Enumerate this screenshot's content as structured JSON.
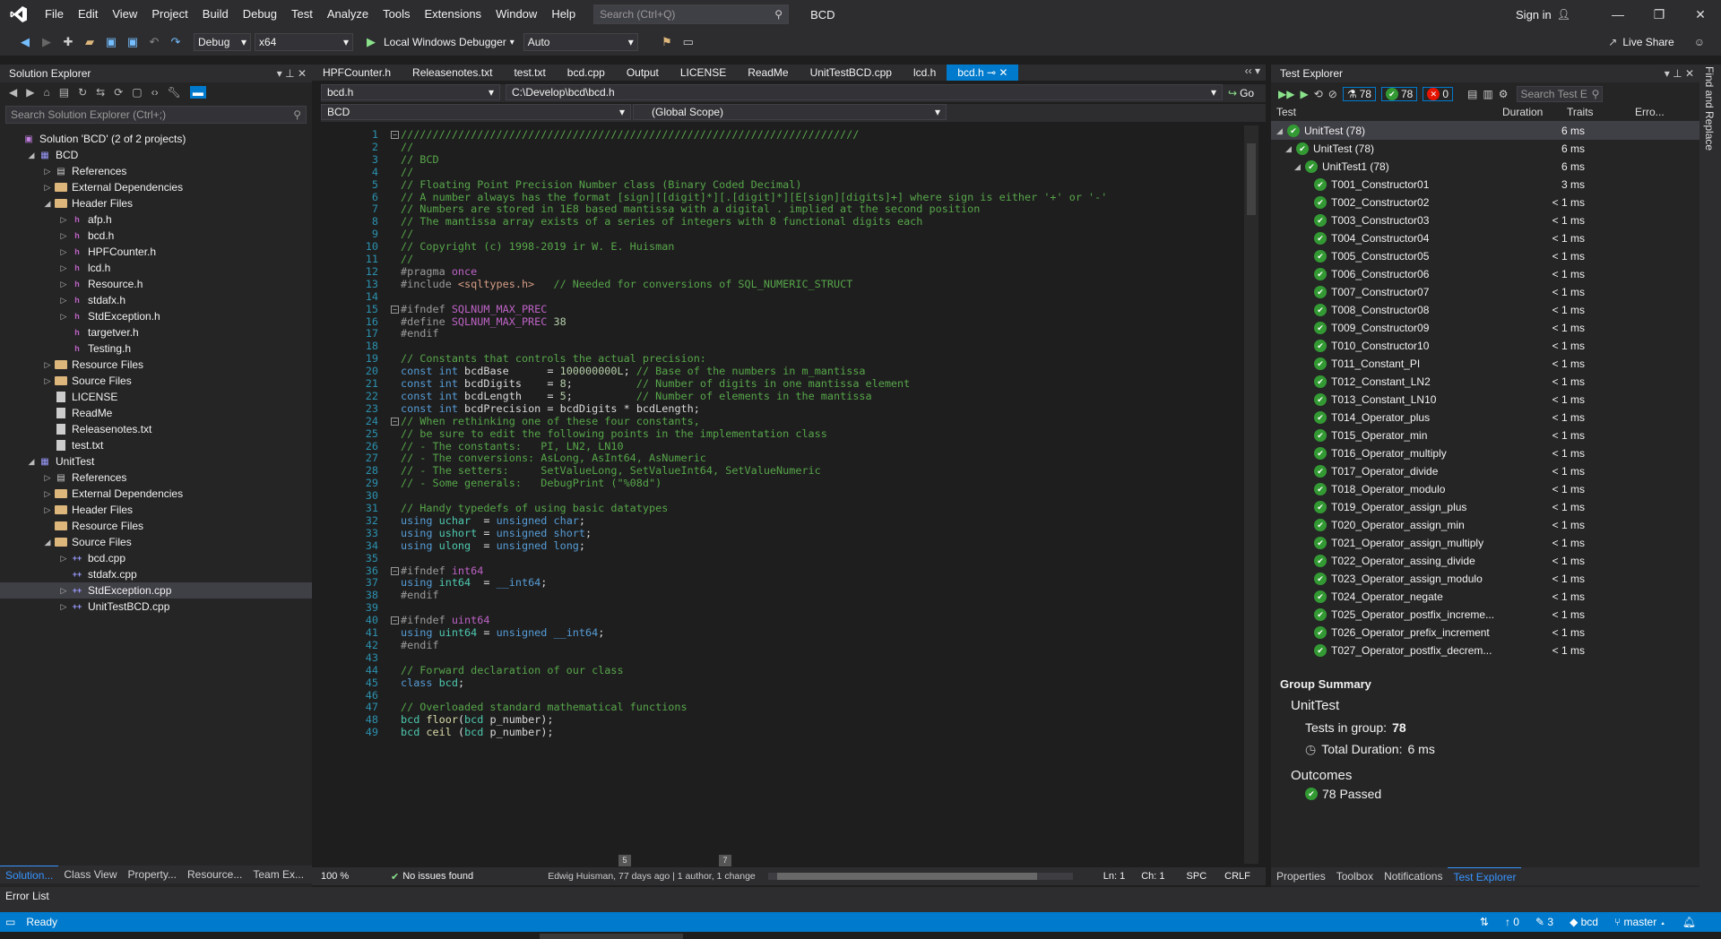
{
  "menubar": {
    "items": [
      "File",
      "Edit",
      "View",
      "Project",
      "Build",
      "Debug",
      "Test",
      "Analyze",
      "Tools",
      "Extensions",
      "Window",
      "Help"
    ],
    "search_placeholder": "Search (Ctrl+Q)",
    "solution_name": "BCD",
    "sign_in": "Sign in"
  },
  "toolbar": {
    "config": "Debug",
    "platform": "x64",
    "debugger": "Local Windows Debugger",
    "auto": "Auto",
    "live_share": "Live Share"
  },
  "solution_explorer": {
    "title": "Solution Explorer",
    "search_placeholder": "Search Solution Explorer (Ctrl+;)",
    "rows": [
      {
        "label": "Solution 'BCD' (2 of 2 projects)",
        "level": 0,
        "tw": "",
        "icon": "solution"
      },
      {
        "label": "BCD",
        "level": 1,
        "tw": "◢",
        "icon": "project"
      },
      {
        "label": "References",
        "level": 2,
        "tw": "▷",
        "icon": "refs"
      },
      {
        "label": "External Dependencies",
        "level": 2,
        "tw": "▷",
        "icon": "folder"
      },
      {
        "label": "Header Files",
        "level": 2,
        "tw": "◢",
        "icon": "folder"
      },
      {
        "label": "afp.h",
        "level": 3,
        "tw": "▷",
        "icon": "h"
      },
      {
        "label": "bcd.h",
        "level": 3,
        "tw": "▷",
        "icon": "h"
      },
      {
        "label": "HPFCounter.h",
        "level": 3,
        "tw": "▷",
        "icon": "h"
      },
      {
        "label": "lcd.h",
        "level": 3,
        "tw": "▷",
        "icon": "h"
      },
      {
        "label": "Resource.h",
        "level": 3,
        "tw": "▷",
        "icon": "h"
      },
      {
        "label": "stdafx.h",
        "level": 3,
        "tw": "▷",
        "icon": "h"
      },
      {
        "label": "StdException.h",
        "level": 3,
        "tw": "▷",
        "icon": "h"
      },
      {
        "label": "targetver.h",
        "level": 3,
        "tw": "",
        "icon": "h"
      },
      {
        "label": "Testing.h",
        "level": 3,
        "tw": "",
        "icon": "h"
      },
      {
        "label": "Resource Files",
        "level": 2,
        "tw": "▷",
        "icon": "folder"
      },
      {
        "label": "Source Files",
        "level": 2,
        "tw": "▷",
        "icon": "folder"
      },
      {
        "label": "LICENSE",
        "level": 2,
        "tw": "",
        "icon": "txt"
      },
      {
        "label": "ReadMe",
        "level": 2,
        "tw": "",
        "icon": "txt"
      },
      {
        "label": "Releasenotes.txt",
        "level": 2,
        "tw": "",
        "icon": "txt"
      },
      {
        "label": "test.txt",
        "level": 2,
        "tw": "",
        "icon": "txt"
      },
      {
        "label": "UnitTest",
        "level": 1,
        "tw": "◢",
        "icon": "project"
      },
      {
        "label": "References",
        "level": 2,
        "tw": "▷",
        "icon": "refs"
      },
      {
        "label": "External Dependencies",
        "level": 2,
        "tw": "▷",
        "icon": "folder"
      },
      {
        "label": "Header Files",
        "level": 2,
        "tw": "▷",
        "icon": "folder"
      },
      {
        "label": "Resource Files",
        "level": 2,
        "tw": "",
        "icon": "folder"
      },
      {
        "label": "Source Files",
        "level": 2,
        "tw": "◢",
        "icon": "folder"
      },
      {
        "label": "bcd.cpp",
        "level": 3,
        "tw": "▷",
        "icon": "cpp"
      },
      {
        "label": "stdafx.cpp",
        "level": 3,
        "tw": "",
        "icon": "cpp"
      },
      {
        "label": "StdException.cpp",
        "level": 3,
        "tw": "▷",
        "icon": "cpp",
        "selected": true
      },
      {
        "label": "UnitTestBCD.cpp",
        "level": 3,
        "tw": "▷",
        "icon": "cpp"
      }
    ],
    "bottom_tabs": [
      "Solution...",
      "Class View",
      "Property...",
      "Resource...",
      "Team Ex..."
    ]
  },
  "editor": {
    "tabs": [
      "HPFCounter.h",
      "Releasenotes.txt",
      "test.txt",
      "bcd.cpp",
      "Output",
      "LICENSE",
      "ReadMe",
      "UnitTestBCD.cpp",
      "lcd.h",
      "bcd.h"
    ],
    "active_tab": "bcd.h",
    "nav_file": "bcd.h",
    "nav_path": "C:\\Develop\\bcd\\bcd.h",
    "nav_go": "Go",
    "nav_project": "BCD",
    "nav_scope": "(Global Scope)",
    "lines": [
      "////////////////////////////////////////////////////////////////////////",
      "//",
      "// BCD",
      "//",
      "// Floating Point Precision Number class (Binary Coded Decimal)",
      "// A number always has the format [sign][[digit]*][.[digit]*][E[sign][digits]+] where sign is either '+' or '-'",
      "// Numbers are stored in 1E8 based mantissa with a digital . implied at the second position",
      "// The mantissa array exists of a series of integers with 8 functional digits each",
      "//",
      "// Copyright (c) 1998-2019 ir W. E. Huisman",
      "//",
      "#pragma once",
      "#include <sqltypes.h>   // Needed for conversions of SQL_NUMERIC_STRUCT",
      "",
      "#ifndef SQLNUM_MAX_PREC",
      "#define SQLNUM_MAX_PREC 38",
      "#endif",
      "",
      "// Constants that controls the actual precision:",
      "const int bcdBase      = 100000000L; // Base of the numbers in m_mantissa",
      "const int bcdDigits    = 8;          // Number of digits in one mantissa element",
      "const int bcdLength    = 5;          // Number of elements in the mantissa",
      "const int bcdPrecision = bcdDigits * bcdLength;",
      "// When rethinking one of these four constants,",
      "// be sure to edit the following points in the implementation class",
      "// - The constants:   PI, LN2, LN10",
      "// - The conversions: AsLong, AsInt64, AsNumeric",
      "// - The setters:     SetValueLong, SetValueInt64, SetValueNumeric",
      "// - Some generals:   DebugPrint (\"%08d\")",
      "",
      "// Handy typedefs of using basic datatypes",
      "using uchar  = unsigned char;",
      "using ushort = unsigned short;",
      "using ulong  = unsigned long;",
      "",
      "#ifndef int64",
      "using int64  = __int64;",
      "#endif",
      "",
      "#ifndef uint64",
      "using uint64 = unsigned __int64;",
      "#endif",
      "",
      "// Forward declaration of our class",
      "class bcd;",
      "",
      "// Overloaded standard mathematical functions",
      "bcd floor(bcd p_number);",
      "bcd ceil (bcd p_number);"
    ],
    "line_numbers": [
      "1",
      "2",
      "3",
      "4",
      "5",
      "6",
      "7",
      "8",
      "9",
      "10",
      "11",
      "12",
      "13",
      "14",
      "15",
      "16",
      "17",
      "18",
      "19",
      "20",
      "21",
      "22",
      "23",
      "24",
      "25",
      "26",
      "27",
      "28",
      "29",
      "30",
      "31",
      "32",
      "33",
      "34",
      "35",
      "36",
      "37",
      "38",
      "39",
      "40",
      "41",
      "42",
      "43",
      "44",
      "45",
      "46",
      "47",
      "48",
      "49"
    ],
    "status": {
      "zoom": "100 %",
      "issues": "No issues found",
      "blame": "Edwig Huisman, 77 days ago | 1 author, 1 change",
      "ln": "Ln: 1",
      "ch": "Ch: 1",
      "spc": "SPC",
      "crlf": "CRLF"
    },
    "scroll_marker_1": "5",
    "scroll_marker_2": "7"
  },
  "test_explorer": {
    "title": "Test Explorer",
    "total_count": "78",
    "passed_count": "78",
    "failed_count": "0",
    "search_placeholder": "Search Test E",
    "columns": {
      "test": "Test",
      "duration": "Duration",
      "traits": "Traits",
      "error": "Erro..."
    },
    "tests": [
      {
        "name": "UnitTest (78)",
        "dur": "6 ms",
        "level": 0
      },
      {
        "name": "UnitTest (78)",
        "dur": "6 ms",
        "level": 1
      },
      {
        "name": "UnitTest1 (78)",
        "dur": "6 ms",
        "level": 2
      },
      {
        "name": "T001_Constructor01",
        "dur": "3 ms",
        "level": 3
      },
      {
        "name": "T002_Constructor02",
        "dur": "< 1 ms",
        "level": 3
      },
      {
        "name": "T003_Constructor03",
        "dur": "< 1 ms",
        "level": 3
      },
      {
        "name": "T004_Constructor04",
        "dur": "< 1 ms",
        "level": 3
      },
      {
        "name": "T005_Constructor05",
        "dur": "< 1 ms",
        "level": 3
      },
      {
        "name": "T006_Constructor06",
        "dur": "< 1 ms",
        "level": 3
      },
      {
        "name": "T007_Constructor07",
        "dur": "< 1 ms",
        "level": 3
      },
      {
        "name": "T008_Constructor08",
        "dur": "< 1 ms",
        "level": 3
      },
      {
        "name": "T009_Constructor09",
        "dur": "< 1 ms",
        "level": 3
      },
      {
        "name": "T010_Constructor10",
        "dur": "< 1 ms",
        "level": 3
      },
      {
        "name": "T011_Constant_PI",
        "dur": "< 1 ms",
        "level": 3
      },
      {
        "name": "T012_Constant_LN2",
        "dur": "< 1 ms",
        "level": 3
      },
      {
        "name": "T013_Constant_LN10",
        "dur": "< 1 ms",
        "level": 3
      },
      {
        "name": "T014_Operator_plus",
        "dur": "< 1 ms",
        "level": 3
      },
      {
        "name": "T015_Operator_min",
        "dur": "< 1 ms",
        "level": 3
      },
      {
        "name": "T016_Operator_multiply",
        "dur": "< 1 ms",
        "level": 3
      },
      {
        "name": "T017_Operator_divide",
        "dur": "< 1 ms",
        "level": 3
      },
      {
        "name": "T018_Operator_modulo",
        "dur": "< 1 ms",
        "level": 3
      },
      {
        "name": "T019_Operator_assign_plus",
        "dur": "< 1 ms",
        "level": 3
      },
      {
        "name": "T020_Operator_assign_min",
        "dur": "< 1 ms",
        "level": 3
      },
      {
        "name": "T021_Operator_assign_multiply",
        "dur": "< 1 ms",
        "level": 3
      },
      {
        "name": "T022_Operator_assing_divide",
        "dur": "< 1 ms",
        "level": 3
      },
      {
        "name": "T023_Operator_assign_modulo",
        "dur": "< 1 ms",
        "level": 3
      },
      {
        "name": "T024_Operator_negate",
        "dur": "< 1 ms",
        "level": 3
      },
      {
        "name": "T025_Operator_postfix_increme...",
        "dur": "< 1 ms",
        "level": 3
      },
      {
        "name": "T026_Operator_prefix_increment",
        "dur": "< 1 ms",
        "level": 3
      },
      {
        "name": "T027_Operator_postfix_decrem...",
        "dur": "< 1 ms",
        "level": 3
      }
    ],
    "summary": {
      "heading": "Group Summary",
      "group": "UnitTest",
      "tests_in_group_label": "Tests in group:",
      "tests_in_group": "78",
      "total_duration_label": "Total Duration:",
      "total_duration": "6 ms",
      "outcomes_label": "Outcomes",
      "passed": "78 Passed"
    },
    "bottom_tabs": [
      "Properties",
      "Toolbox",
      "Notifications",
      "Test Explorer"
    ]
  },
  "side_strip": "Find and Replace",
  "error_list": "Error List",
  "statusbar": {
    "ready": "Ready",
    "up": "0",
    "pencil": "3",
    "repo": "bcd",
    "branch": "master"
  }
}
